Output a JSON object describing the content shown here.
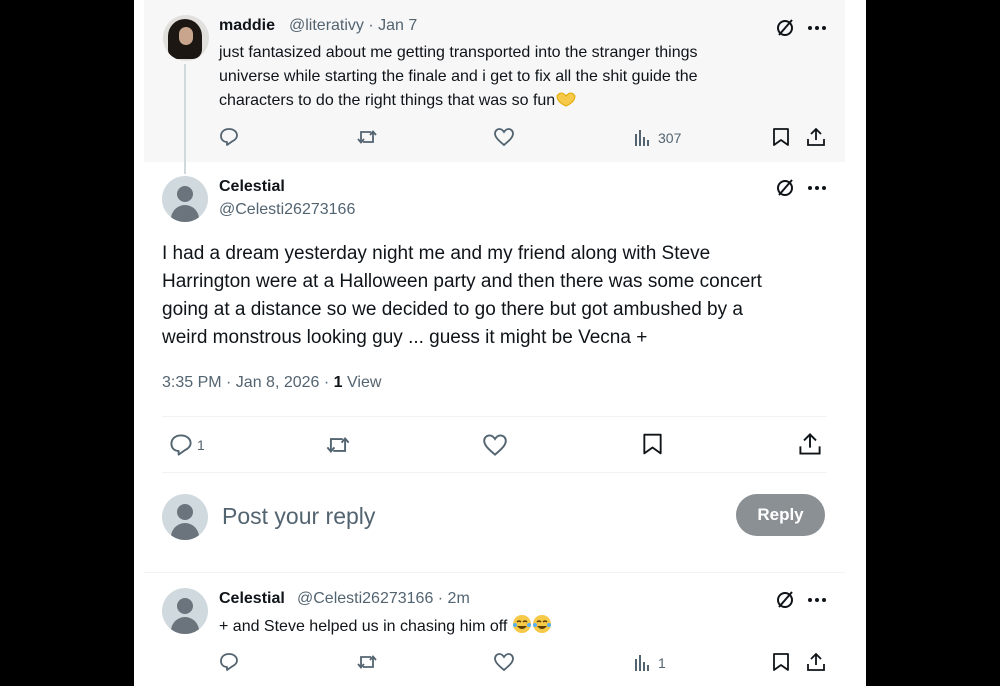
{
  "parent_tweet": {
    "author_name": "maddie",
    "handle_time": "@literativy · Jan 7",
    "lines": [
      "just fantasized about me getting transported into the stranger things",
      "universe while starting the finale and i get to fix all the shit guide the",
      "characters to do the right things that was so fun"
    ],
    "emoji": "heart-hands-emoji",
    "views": "307"
  },
  "main_tweet": {
    "author_name": "Celestial",
    "handle": "@Celesti26273166",
    "lines": [
      "I had a dream yesterday night me and my friend along with Steve",
      "Harrington were at a Halloween party and then there was some concert",
      "going at a distance so we decided to go there but got ambushed by a",
      "weird monstrous looking guy ... guess it might be Vecna +"
    ],
    "timestamp": "3:35 PM · Jan 8, 2026 · ",
    "view_count": "1",
    "view_label": "View",
    "reply_count": "1"
  },
  "composer": {
    "placeholder": "Post your reply",
    "reply_label": "Reply"
  },
  "reply_tweet": {
    "author_name": "Celestial",
    "handle_time": "@Celesti26273166 · 2m",
    "text": "+ and Steve helped us in chasing him off",
    "emojis": [
      "tears-of-joy-emoji",
      "tears-of-joy-emoji"
    ],
    "views": "1"
  },
  "colors": {
    "background": "#000000",
    "panel": "#ffffff",
    "parent_bg": "#f7f7f7",
    "text": "#0f1419",
    "muted": "#536471",
    "reply_button": "#8b9095"
  }
}
